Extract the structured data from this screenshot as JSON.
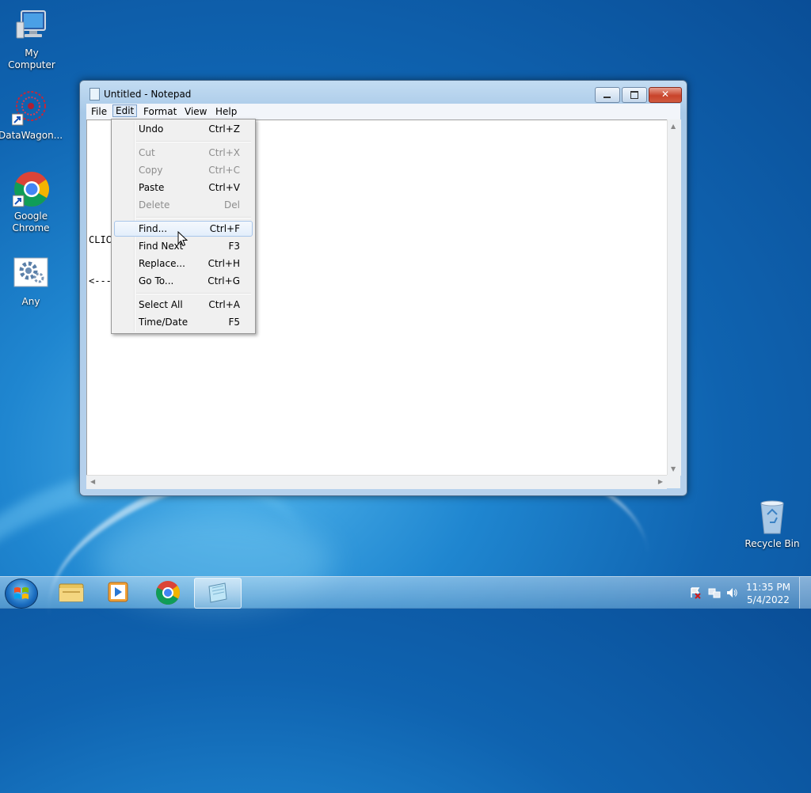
{
  "desktop": {
    "icons": [
      {
        "label": "My Computer"
      },
      {
        "label": "DataWagon..."
      },
      {
        "label": "Google Chrome"
      },
      {
        "label": "Any"
      },
      {
        "label": "Recycle Bin"
      }
    ]
  },
  "window": {
    "title": "Untitled - Notepad",
    "close_symbol": "✕",
    "menu": [
      "File",
      "Edit",
      "Format",
      "View",
      "Help"
    ],
    "active_menu": "Edit",
    "content_lines": [
      "CLIC",
      "<---"
    ]
  },
  "edit_menu": {
    "items": [
      {
        "label": "Undo",
        "shortcut": "Ctrl+Z",
        "enabled": true
      },
      {
        "label": "Cut",
        "shortcut": "Ctrl+X",
        "enabled": false
      },
      {
        "label": "Copy",
        "shortcut": "Ctrl+C",
        "enabled": false
      },
      {
        "label": "Paste",
        "shortcut": "Ctrl+V",
        "enabled": true
      },
      {
        "label": "Delete",
        "shortcut": "Del",
        "enabled": false
      },
      {
        "label": "Find...",
        "shortcut": "Ctrl+F",
        "enabled": true,
        "highlighted": true
      },
      {
        "label": "Find Next",
        "shortcut": "F3",
        "enabled": true
      },
      {
        "label": "Replace...",
        "shortcut": "Ctrl+H",
        "enabled": true
      },
      {
        "label": "Go To...",
        "shortcut": "Ctrl+G",
        "enabled": true
      },
      {
        "label": "Select All",
        "shortcut": "Ctrl+A",
        "enabled": true
      },
      {
        "label": "Time/Date",
        "shortcut": "F5",
        "enabled": true
      }
    ]
  },
  "taskbar": {
    "pinned": [
      "windows-explorer-icon",
      "media-player-icon",
      "chrome-icon",
      "notepad-icon"
    ],
    "tray_icons": [
      "action-center-icon",
      "network-icon",
      "volume-icon"
    ],
    "time": "11:35 PM",
    "date": "5/4/2022"
  },
  "colors": {
    "menu_highlight_border": "#a9c6ea",
    "disabled_text": "#8d8d8d"
  }
}
